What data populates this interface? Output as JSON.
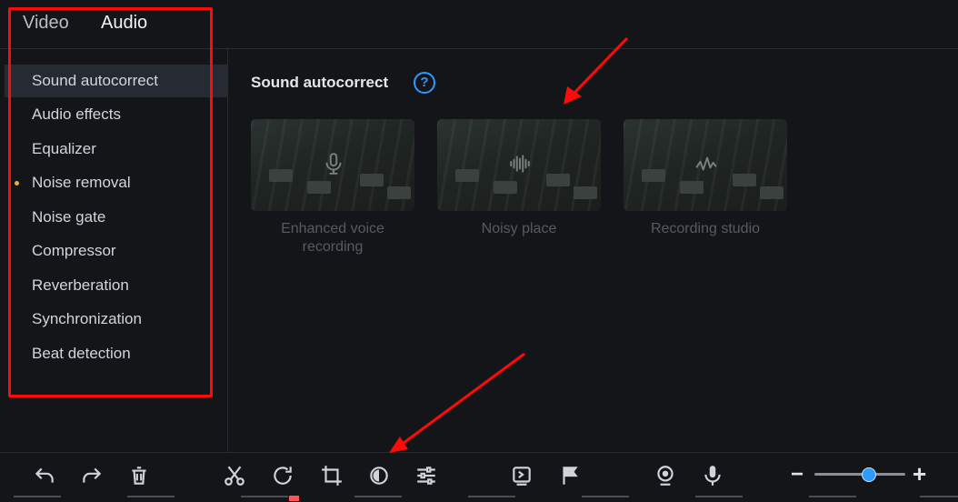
{
  "tabs": {
    "video": "Video",
    "audio": "Audio"
  },
  "sidebar": {
    "items": [
      {
        "label": "Sound autocorrect"
      },
      {
        "label": "Audio effects"
      },
      {
        "label": "Equalizer"
      },
      {
        "label": "Noise removal"
      },
      {
        "label": "Noise gate"
      },
      {
        "label": "Compressor"
      },
      {
        "label": "Reverberation"
      },
      {
        "label": "Synchronization"
      },
      {
        "label": "Beat detection"
      }
    ]
  },
  "main": {
    "title": "Sound autocorrect",
    "help_glyph": "?",
    "presets": [
      {
        "label_line1": "Enhanced voice",
        "label_line2": "recording",
        "icon": "microphone-icon"
      },
      {
        "label_line1": "Noisy place",
        "label_line2": "",
        "icon": "waveform-icon"
      },
      {
        "label_line1": "Recording studio",
        "label_line2": "",
        "icon": "pulse-icon"
      }
    ]
  },
  "toolbar": {
    "icons": [
      "undo-icon",
      "redo-icon",
      "delete-icon",
      "cut-icon",
      "rotate-icon",
      "crop-icon",
      "color-adjust-icon",
      "settings-sliders-icon",
      "export-icon",
      "marker-flag-icon",
      "webcam-icon",
      "microphone-icon"
    ],
    "zoom_minus": "−",
    "zoom_plus": "+",
    "zoom_level": 0.6
  },
  "colors": {
    "accent": "#2d9aff",
    "highlight_box": "#ff0a0a",
    "dot": "#e0b43c",
    "background": "#131519"
  }
}
